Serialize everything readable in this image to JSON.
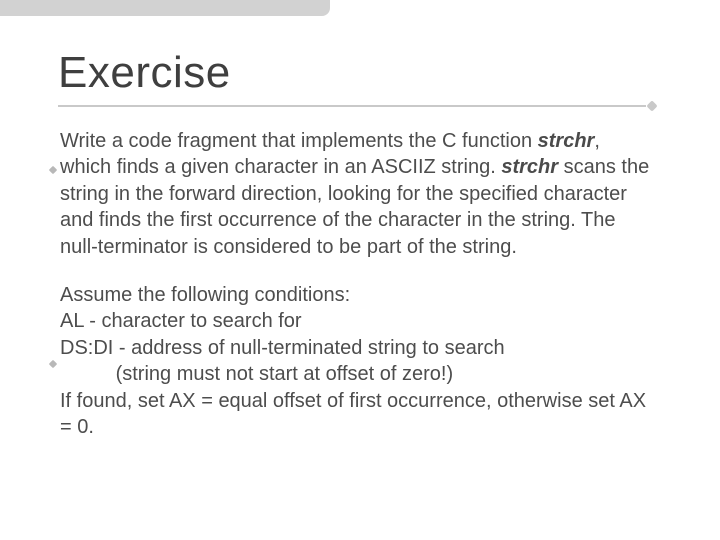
{
  "slide": {
    "title": "Exercise",
    "para1": {
      "s1a": "Write a code fragment that implements the C function ",
      "kw1": "strchr",
      "s1b": ", which finds a given character in an ASCIIZ string. ",
      "kw2": "strchr",
      "s1c": " scans the string in the forward direction, looking for the specified character and finds the first occurrence of the character in the string. The null-terminator is considered to be part of the string."
    },
    "para2": {
      "l1": "Assume the following conditions:",
      "l2": "AL - character to search for",
      "l3": "DS:DI - address of null-terminated string to search",
      "l4": "          (string must not start at offset of zero!)",
      "l5": "If found, set AX = equal offset of first occurrence, otherwise set AX = 0."
    }
  }
}
